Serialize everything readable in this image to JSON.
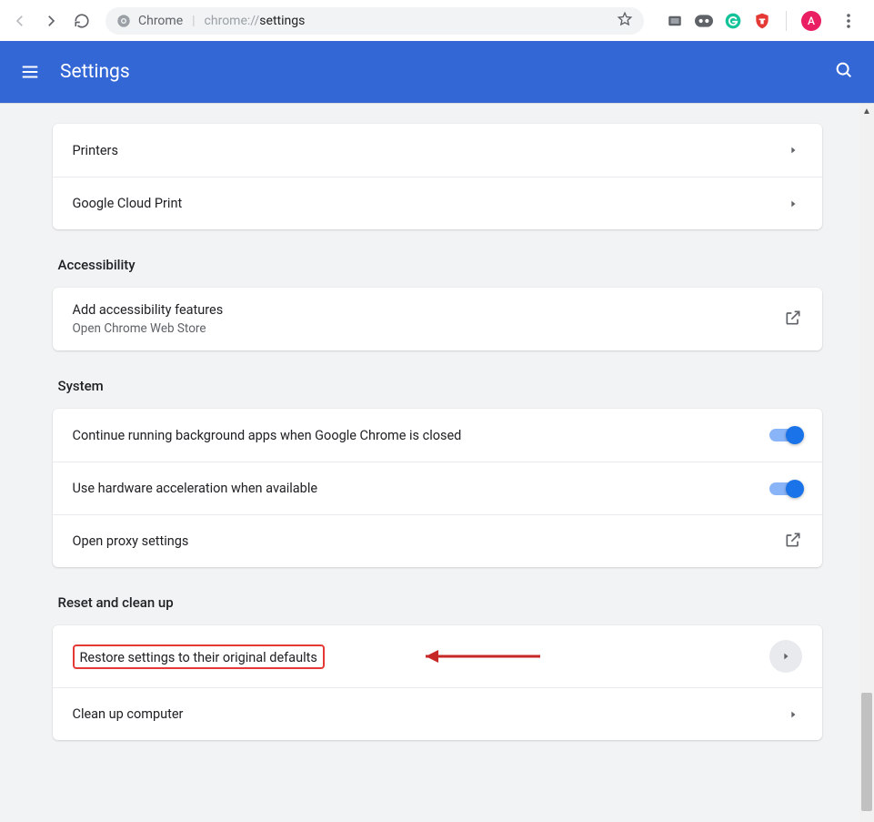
{
  "toolbar": {
    "omnibox_label": "Chrome",
    "url_prefix": "chrome://",
    "url_path": "settings",
    "avatar_letter": "A"
  },
  "header": {
    "title": "Settings"
  },
  "sections": {
    "printing": {
      "items": [
        "Printers",
        "Google Cloud Print"
      ]
    },
    "accessibility": {
      "title": "Accessibility",
      "item_label": "Add accessibility features",
      "item_sub": "Open Chrome Web Store"
    },
    "system": {
      "title": "System",
      "row1": "Continue running background apps when Google Chrome is closed",
      "row2": "Use hardware acceleration when available",
      "row3": "Open proxy settings"
    },
    "reset": {
      "title": "Reset and clean up",
      "row1": "Restore settings to their original defaults",
      "row2": "Clean up computer"
    }
  }
}
